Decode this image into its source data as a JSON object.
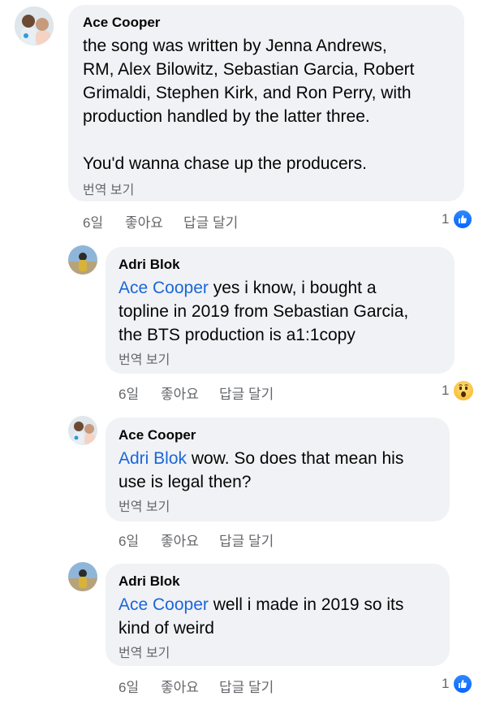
{
  "comments": [
    {
      "author": "Ace Cooper",
      "text_lines": [
        "the song was written by Jenna Andrews,",
        "RM, Alex Bilowitz, Sebastian Garcia, Robert",
        "Grimaldi, Stephen Kirk, and Ron Perry, with",
        "production handled by the latter three.",
        "",
        "You'd wanna chase up the producers."
      ],
      "translate": "번역 보기",
      "age": "6일",
      "like": "좋아요",
      "reply": "답글 달기",
      "reaction_count": "1",
      "reaction": "like-icon"
    },
    {
      "author": "Adri Blok",
      "mention": "Ace Cooper",
      "text_first": " yes i know, i bought a",
      "text_lines": [
        "topline in 2019 from Sebastian Garcia,",
        "the BTS production is a1:1copy"
      ],
      "translate": "번역 보기",
      "age": "6일",
      "like": "좋아요",
      "reply": "답글 달기",
      "reaction_count": "1",
      "reaction": "wow-icon"
    },
    {
      "author": "Ace Cooper",
      "mention": "Adri Blok",
      "text_first": " wow. So does that mean his",
      "text_lines": [
        "use is legal then?"
      ],
      "translate": "번역 보기",
      "age": "6일",
      "like": "좋아요",
      "reply": "답글 달기"
    },
    {
      "author": "Adri Blok",
      "mention": "Ace Cooper",
      "text_first": " well i made in 2019 so its",
      "text_lines": [
        "kind of weird"
      ],
      "translate": "번역 보기",
      "age": "6일",
      "like": "좋아요",
      "reply": "답글 달기",
      "reaction_count": "1",
      "reaction": "like-icon"
    }
  ],
  "colors": {
    "bubble": "#f0f2f5",
    "mention": "#1b66d8",
    "meta": "#65676b",
    "like_badge": "#0866ff"
  }
}
